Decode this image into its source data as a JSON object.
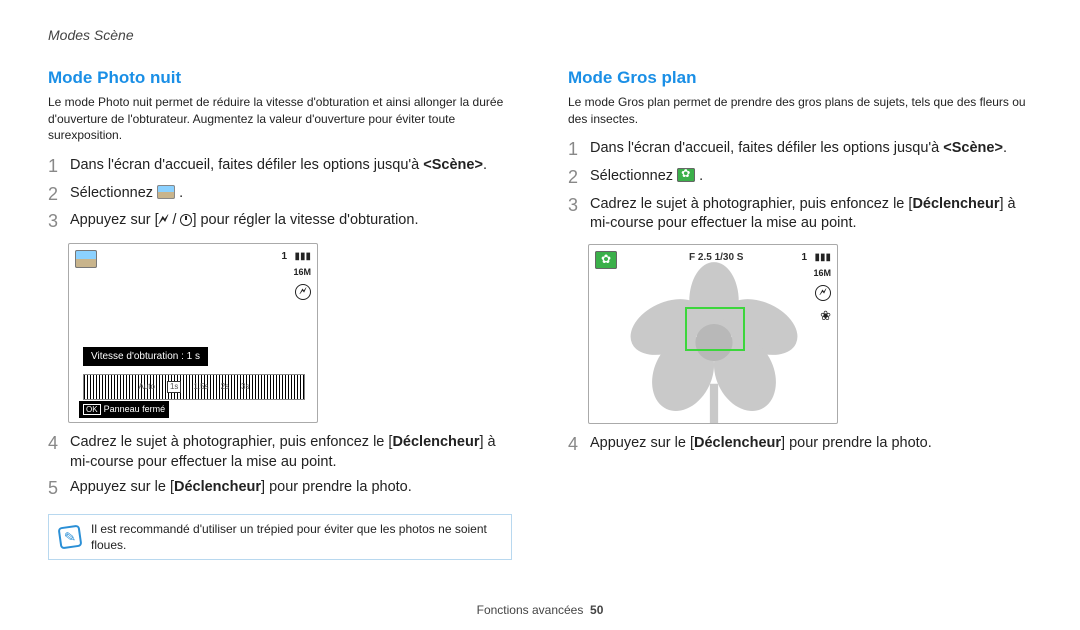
{
  "breadcrumb": "Modes Scène",
  "left": {
    "title": "Mode Photo nuit",
    "intro": "Le mode Photo nuit permet de réduire la vitesse d'obturation et ainsi allonger la durée d'ouverture de l'obturateur. Augmentez la valeur d'ouverture pour éviter toute surexposition.",
    "step1": "Dans l'écran d'accueil, faites défiler les options jusqu'à ",
    "step1_bold": "<Scène>",
    "step1_end": ".",
    "step2": "Sélectionnez ",
    "step2_end": " .",
    "step3a": "Appuyez sur [",
    "step3b": "] pour régler la vitesse d'obturation.",
    "preview": {
      "count": "1",
      "size": "16M",
      "shutter_label": "Vitesse d'obturation : 1 s",
      "ruler": [
        "Auto",
        "1s",
        "1.5s",
        "2s",
        "3s"
      ],
      "ok_key": "OK",
      "ok_label": "Panneau fermé"
    },
    "step4a": "Cadrez le sujet à photographier, puis enfoncez le [",
    "step4_bold": "Déclencheur",
    "step4b": "] à mi-course pour effectuer la mise au point.",
    "step5a": "Appuyez sur le [",
    "step5_bold": "Déclencheur",
    "step5b": "] pour prendre la photo.",
    "note": "Il est recommandé d'utiliser un trépied pour éviter que les photos ne soient floues."
  },
  "right": {
    "title": "Mode Gros plan",
    "intro": "Le mode Gros plan permet de prendre des gros plans de sujets, tels que des fleurs ou des insectes.",
    "step1": "Dans l'écran d'accueil, faites défiler les options jusqu'à ",
    "step1_bold": "<Scène>",
    "step1_end": ".",
    "step2": "Sélectionnez ",
    "step2_end": " .",
    "step3a": "Cadrez le sujet à photographier, puis enfoncez le [",
    "step3_bold": "Déclencheur",
    "step3b": "] à mi-course pour effectuer la mise au point.",
    "preview": {
      "fstop": "F 2.5 1/30 S",
      "count": "1",
      "size": "16M"
    },
    "step4a": "Appuyez sur le [",
    "step4_bold": "Déclencheur",
    "step4b": "] pour prendre la photo."
  },
  "footer": {
    "section": "Fonctions avancées",
    "page": "50"
  }
}
